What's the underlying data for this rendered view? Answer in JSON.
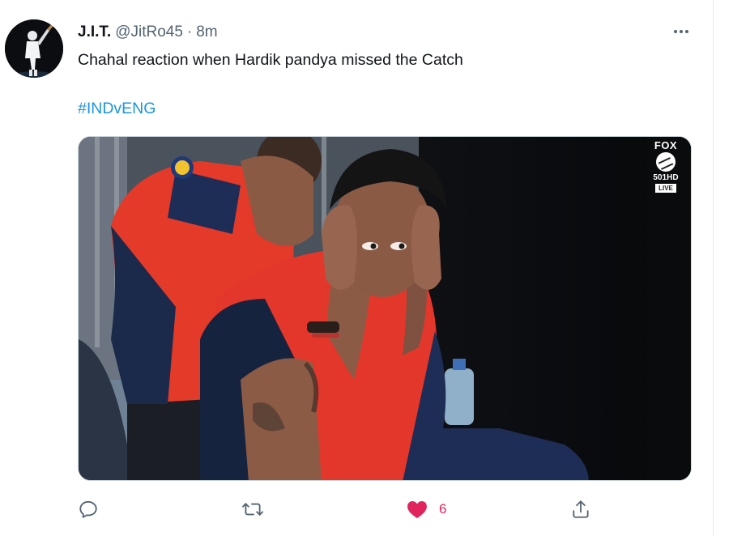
{
  "tweet": {
    "author": {
      "display_name": "J.I.T.",
      "handle": "@JitRo45",
      "separator": "·",
      "time": "8m"
    },
    "text": "Chahal reaction when Hardik pandya missed the Catch",
    "hashtag": "#INDvENG",
    "media": {
      "broadcaster_logo": {
        "word": "FOX",
        "channel": "501HD",
        "live": "LIVE"
      }
    },
    "actions": {
      "reply_icon": "reply-icon",
      "retweet_icon": "retweet-icon",
      "like_icon": "heart-filled-icon",
      "like_count": "6",
      "share_icon": "share-icon"
    }
  },
  "colors": {
    "link": "#1b95e0",
    "like": "#e0245e",
    "secondary_text": "#536471",
    "primary_text": "#0f1419",
    "divider": "#e6ecf0"
  }
}
